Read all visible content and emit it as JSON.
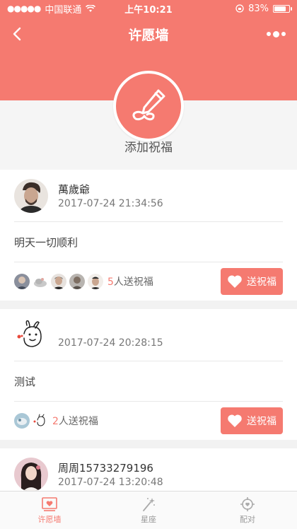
{
  "statusbar": {
    "carrier": "中国联通",
    "time": "上午10:21",
    "battery": "83%",
    "battery_level": 0.83
  },
  "nav": {
    "title": "许愿墙"
  },
  "hero": {
    "label": "添加祝福"
  },
  "posts": [
    {
      "name": "萬歲爺",
      "time": "2017-07-24 21:34:56",
      "message": "明天一切顺利",
      "bless_num": "5",
      "bless_suffix": "人送祝福",
      "button": "送祝福"
    },
    {
      "name": "",
      "time": "2017-07-24 20:28:15",
      "message": "测试",
      "bless_num": "2",
      "bless_suffix": "人送祝福",
      "button": "送祝福"
    },
    {
      "name": "周周15733279196",
      "time": "2017-07-24 13:20:48"
    }
  ],
  "tabs": [
    {
      "label": "许愿墙",
      "icon": "wish-wall-icon",
      "active": true
    },
    {
      "label": "星座",
      "icon": "magic-wand-icon",
      "active": false
    },
    {
      "label": "配对",
      "icon": "target-icon",
      "active": false
    }
  ],
  "colors": {
    "accent": "#f57a70",
    "background": "#f2f2f2"
  }
}
